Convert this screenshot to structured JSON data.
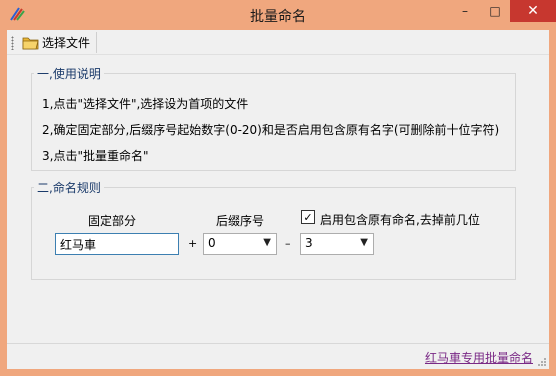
{
  "window": {
    "title": "批量命名"
  },
  "titlebar": {
    "minimize": "–",
    "maximize": "□",
    "close": "✕"
  },
  "toolbar": {
    "select_file_label": "选择文件"
  },
  "instructions": {
    "title": "一,使用说明",
    "lines": [
      "1,点击\"选择文件\",选择设为首项的文件",
      "2,确定固定部分,后缀序号起始数字(0-20)和是否启用包含原有名字(可删除前十位字符)",
      "3,点击\"批量重命名\""
    ]
  },
  "rules": {
    "title": "二,命名规则",
    "fixed_label": "固定部分",
    "suffix_label": "后缀序号",
    "keep_label": "启用包含原有命名,去掉前几位",
    "keep_checked": "✓",
    "fixed_value": "红马車",
    "plus": "+",
    "suffix_value": "0",
    "minus": "–",
    "trim_value": "3"
  },
  "status": {
    "link": "红马車专用批量命名"
  }
}
